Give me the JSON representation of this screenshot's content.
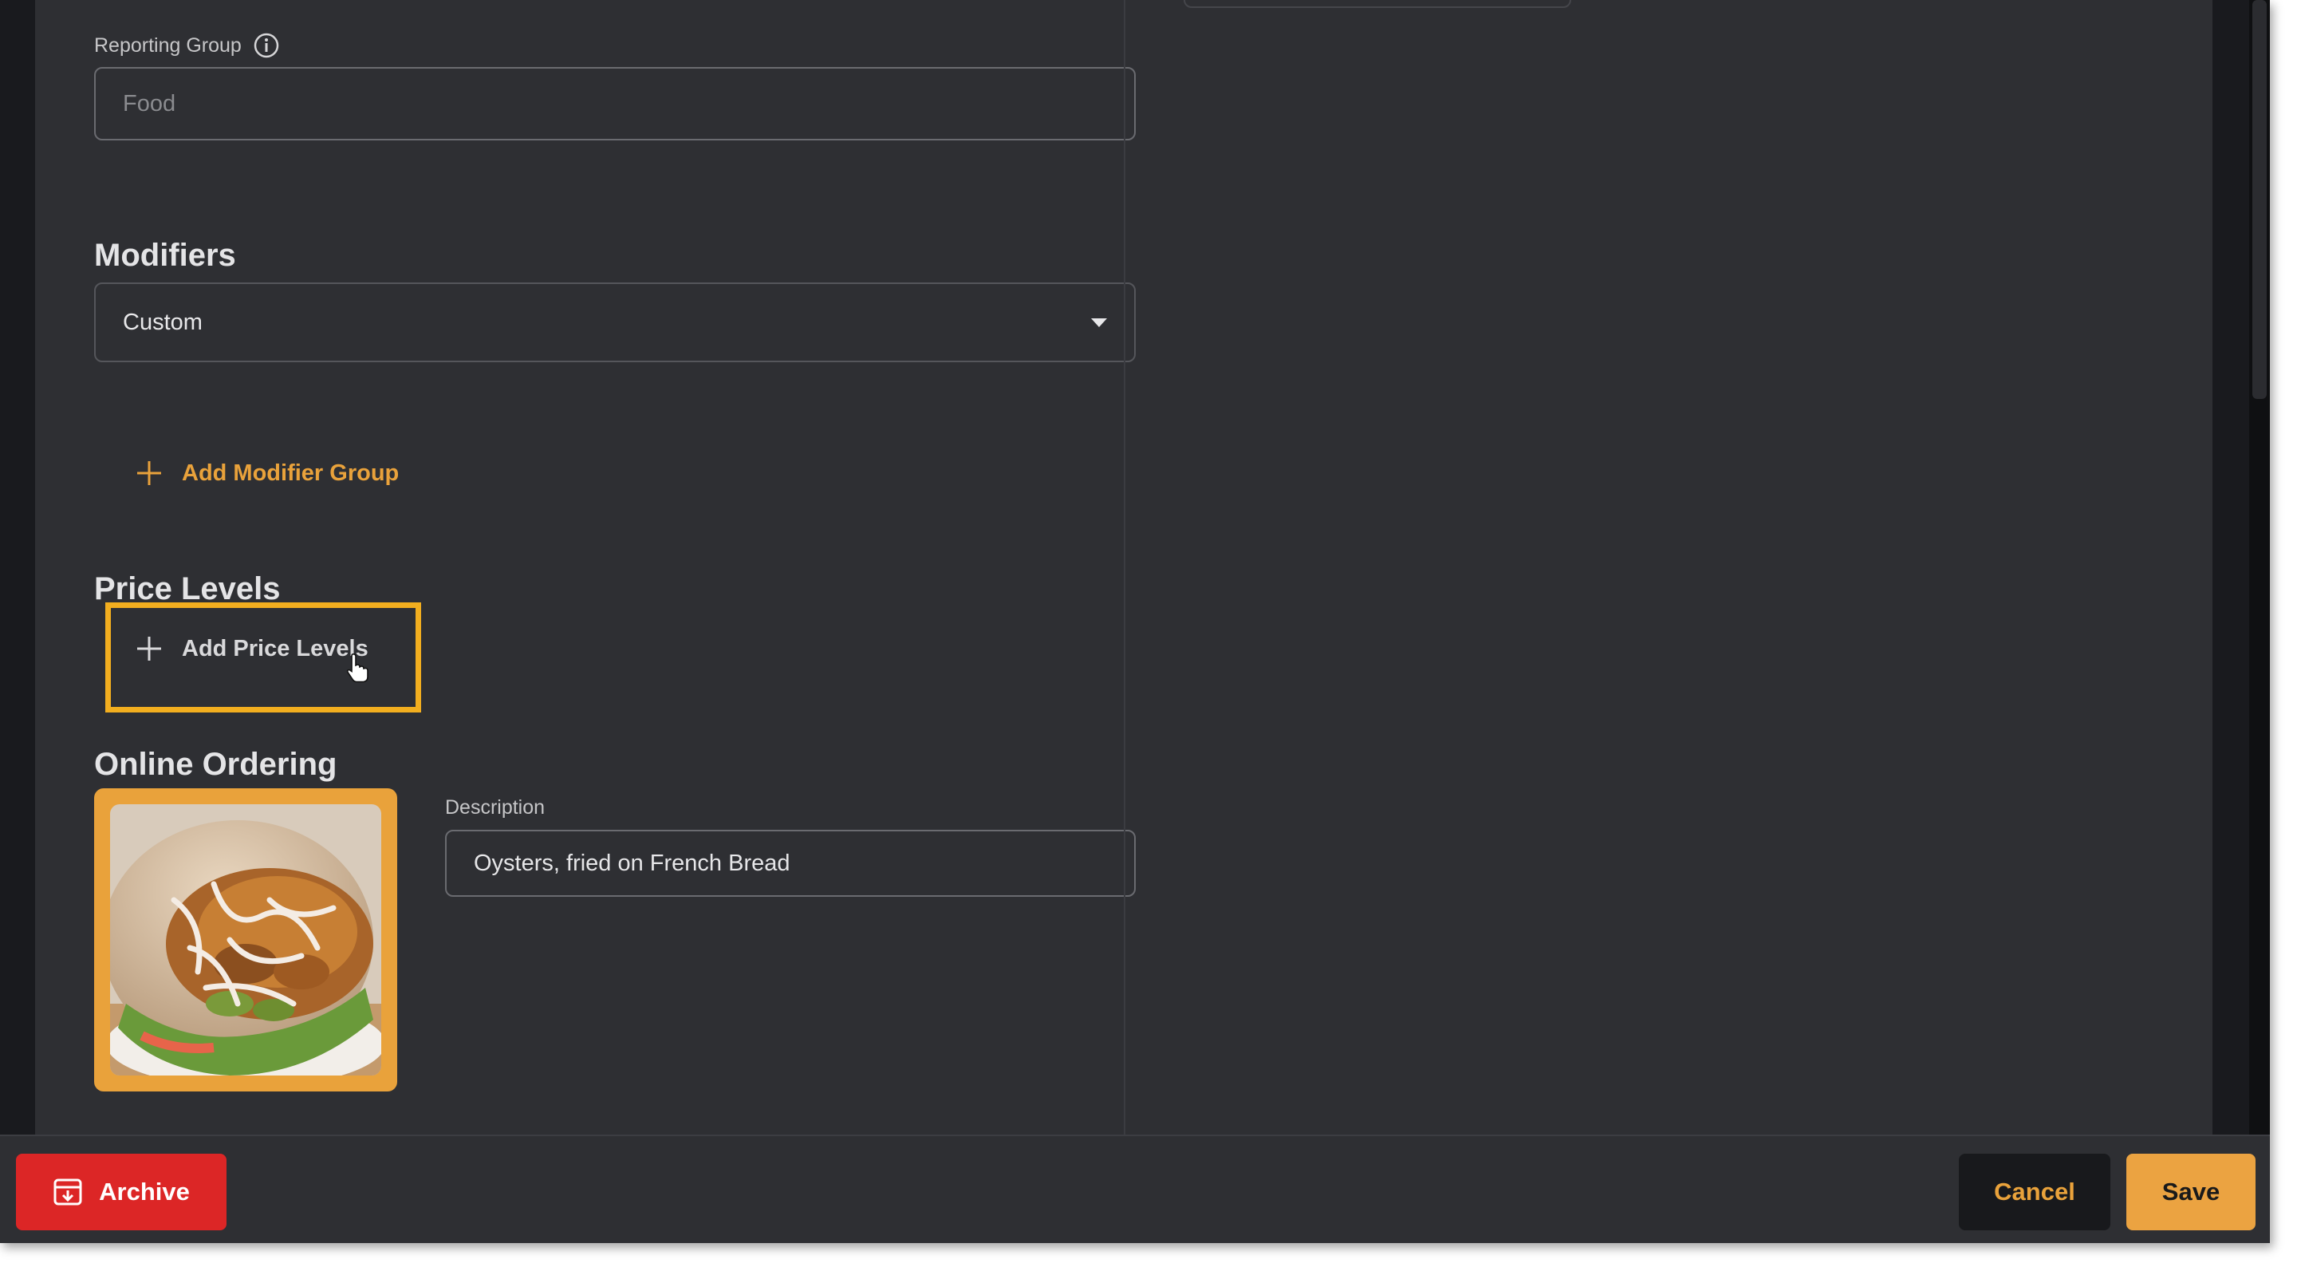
{
  "reporting_group": {
    "label": "Reporting Group",
    "placeholder": "Food"
  },
  "modifiers": {
    "title": "Modifiers",
    "selected": "Custom",
    "add_label": "Add Modifier Group"
  },
  "price_levels": {
    "title": "Price Levels",
    "add_label": "Add Price Levels"
  },
  "online_ordering": {
    "title": "Online Ordering",
    "description_label": "Description",
    "description_value": "Oysters, fried on French Bread"
  },
  "footer": {
    "archive_label": "Archive",
    "cancel_label": "Cancel",
    "save_label": "Save"
  },
  "icons": {
    "info": "info-icon",
    "plus": "plus-icon",
    "caret": "chevron-down-icon",
    "archive": "archive-icon",
    "cursor": "hand-pointer-icon"
  },
  "colors": {
    "accent": "#e9a23b",
    "danger": "#dc2626",
    "panel": "#2e2f33",
    "background": "#191a1e",
    "highlight": "#f2ae1f"
  }
}
